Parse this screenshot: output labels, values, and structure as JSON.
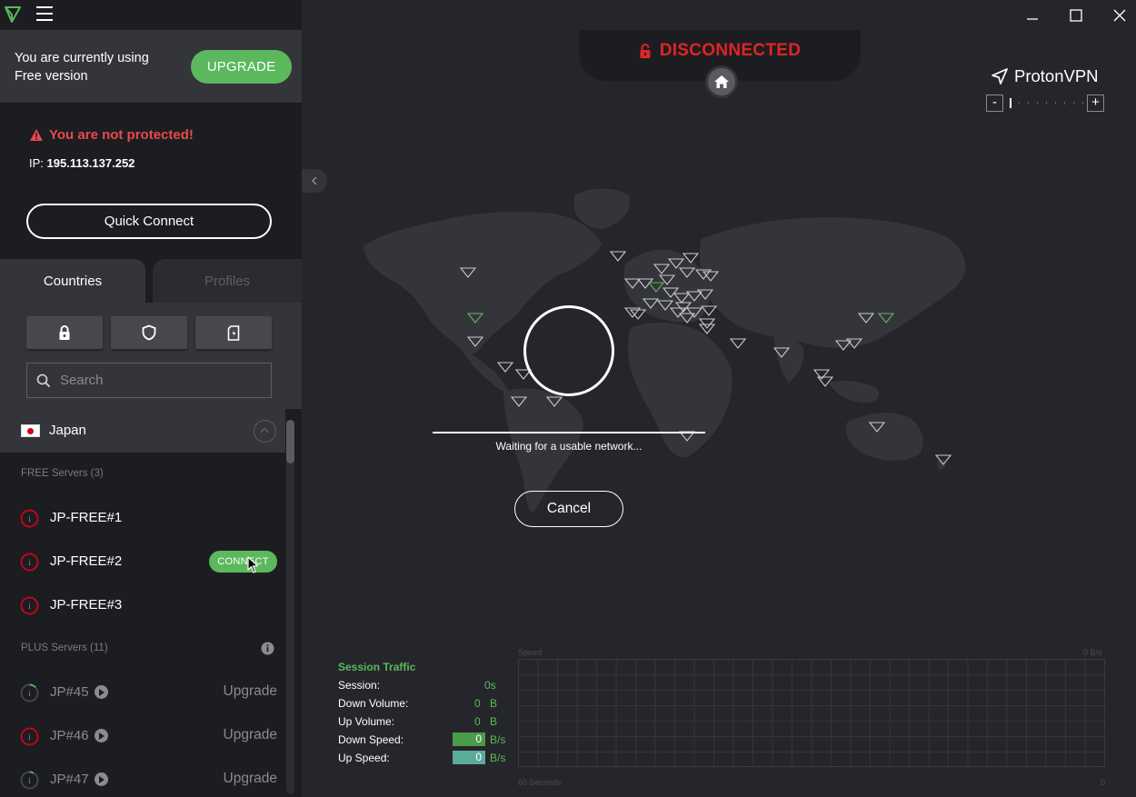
{
  "window": {
    "minimize_icon": "minimize-icon",
    "maximize_icon": "maximize-icon",
    "close_icon": "close-icon"
  },
  "sidebar": {
    "free_notice_line1": "You are currently using",
    "free_notice_line2": "Free version",
    "upgrade_label": "UPGRADE",
    "warning": "You are not protected!",
    "ip_label": "IP:",
    "ip_value": "195.113.137.252",
    "quick_connect": "Quick Connect",
    "tabs": [
      {
        "label": "Countries",
        "active": true
      },
      {
        "label": "Profiles",
        "active": false
      }
    ],
    "filters": [
      "lock-icon",
      "shield-icon",
      "sd-card-icon"
    ],
    "search_placeholder": "Search",
    "country": {
      "name": "Japan",
      "flag": "japan-flag"
    },
    "free_section": "FREE Servers (3)",
    "free_servers": [
      {
        "name": "JP-FREE#1"
      },
      {
        "name": "JP-FREE#2",
        "action": "CONNECT"
      },
      {
        "name": "JP-FREE#3"
      }
    ],
    "plus_section": "PLUS Servers (11)",
    "plus_servers": [
      {
        "name": "JP#45",
        "action": "Upgrade"
      },
      {
        "name": "JP#46",
        "action": "Upgrade"
      },
      {
        "name": "JP#47",
        "action": "Upgrade"
      }
    ]
  },
  "main": {
    "status": "DISCONNECTED",
    "brand": "ProtonVPN",
    "zoom_minus": "-",
    "zoom_plus": "+",
    "waiting": "Waiting for a usable network...",
    "cancel": "Cancel",
    "colors": {
      "accent": "#5cb85c",
      "danger": "#e02424",
      "warning": "#e84a4a"
    }
  },
  "traffic": {
    "title": "Session Traffic",
    "session_label": "Session:",
    "session_value": "0s",
    "down_volume_label": "Down Volume:",
    "down_volume_value": "0",
    "down_volume_unit": "B",
    "up_volume_label": "Up Volume:",
    "up_volume_value": "0",
    "up_volume_unit": "B",
    "down_speed_label": "Down Speed:",
    "down_speed_value": "0",
    "down_speed_unit": "B/s",
    "up_speed_label": "Up Speed:",
    "up_speed_value": "0",
    "up_speed_unit": "B/s"
  },
  "graph": {
    "top_left": "Speed",
    "top_right_value": "0",
    "top_right_unit": "B/s",
    "bottom_left": "60 Seconds",
    "bottom_right": "0"
  }
}
